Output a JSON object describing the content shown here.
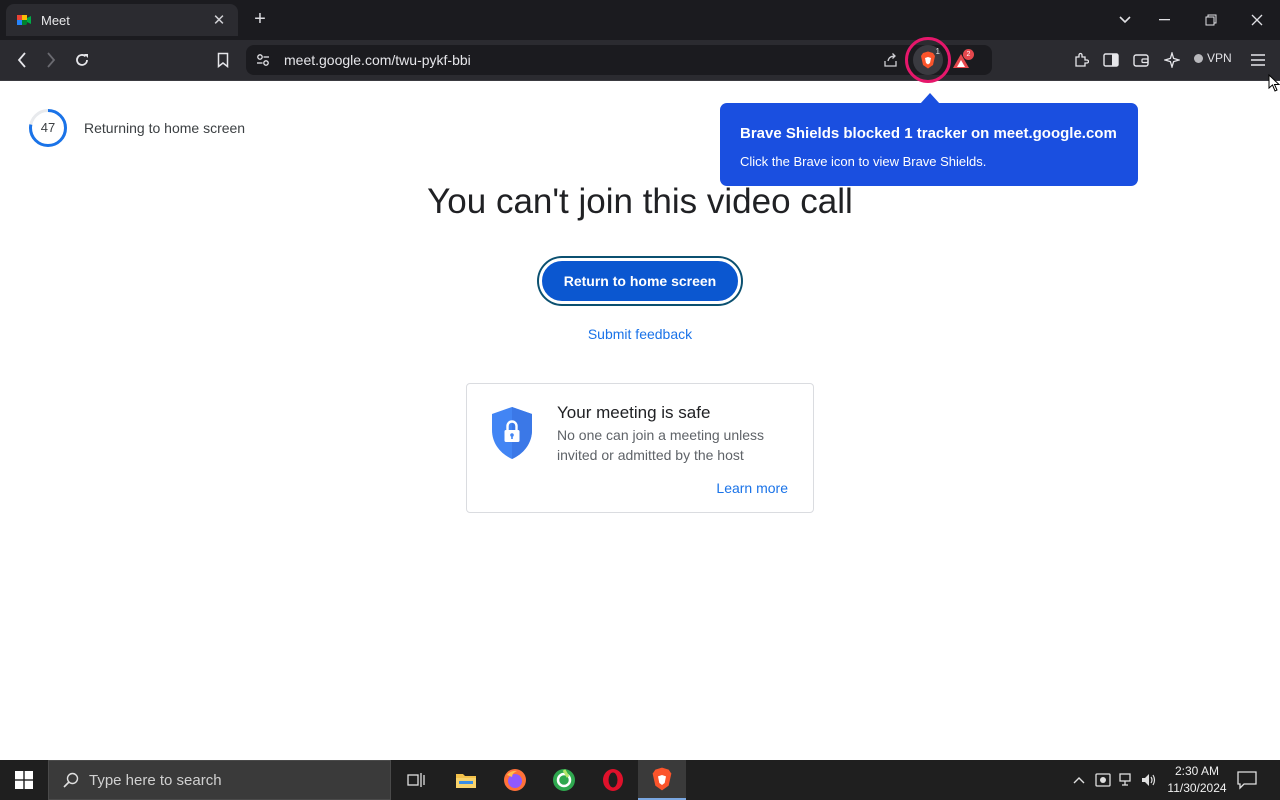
{
  "browser": {
    "tab": {
      "title": "Meet",
      "close": "✕"
    },
    "new_tab": "+",
    "url": "meet.google.com/twu-pykf-bbi",
    "shield_count": "1",
    "rewards_count": "2",
    "vpn_label": "VPN"
  },
  "tooltip": {
    "title": "Brave Shields blocked 1 tracker on meet.google.com",
    "subtitle": "Click the Brave icon to view Brave Shields."
  },
  "page": {
    "countdown_value": "47",
    "countdown_fraction": 0.78,
    "returning_text": "Returning to home screen",
    "headline": "You can't join this video call",
    "return_button": "Return to home screen",
    "feedback_link": "Submit feedback",
    "safe_card": {
      "title": "Your meeting is safe",
      "description": "No one can join a meeting unless invited or admitted by the host",
      "learn_more": "Learn more"
    }
  },
  "taskbar": {
    "search_placeholder": "Type here to search",
    "time": "2:30 AM",
    "date": "11/30/2024"
  },
  "colors": {
    "accent_blue": "#0b57d0",
    "link_blue": "#1a73e8",
    "tooltip_blue": "#1a4fe0",
    "shield_ring": "#e6176b"
  }
}
